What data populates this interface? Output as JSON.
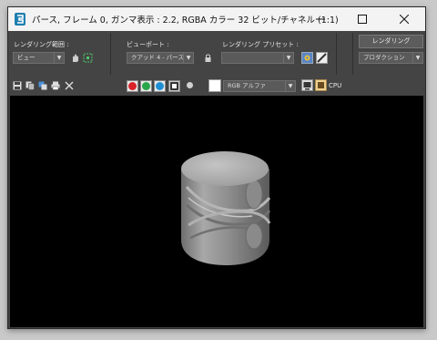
{
  "window": {
    "title": "パース, フレーム 0, ガンマ表示 : 2.2, RGBA カラー 32 ビット/チャネル (1:1)",
    "minimize_icon": "minimize-icon",
    "maximize_icon": "maximize-icon",
    "close_icon": "close-icon"
  },
  "toolbar": {
    "render_area_label": "レンダリング範囲 :",
    "render_area_value": "ビュー",
    "viewport_label": "ビューポート :",
    "viewport_value": "クアッド 4 - パース",
    "preset_label": "レンダリング プリセット :",
    "preset_value": "",
    "render_button": "レンダリング",
    "production_value": "プロダクション"
  },
  "toolbar2": {
    "channel_value": "RGB アルファ",
    "cpu_label": "CPU",
    "colors": {
      "red": "#d8232a",
      "green": "#2aa64a",
      "blue": "#1e8fd5"
    }
  }
}
